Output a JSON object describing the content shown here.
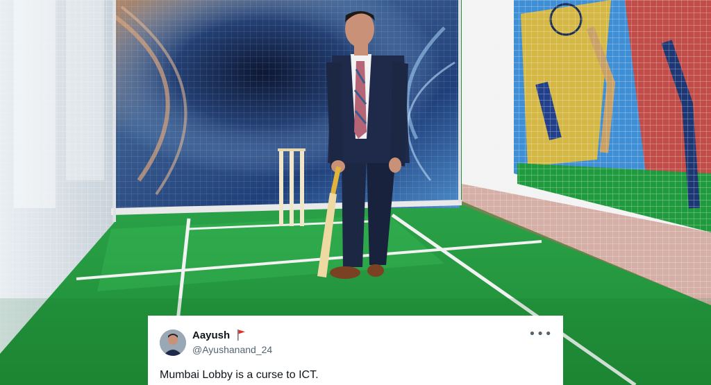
{
  "photo": {
    "description_icon": "cricket-practice-net-photo",
    "colors": {
      "turf": "#2e9a41",
      "net": "#e8ecef",
      "suit": "#1c2743",
      "backdrop": "#274a7a",
      "wall": "#f2f2f2"
    }
  },
  "tweet": {
    "display_name": "Aayush",
    "handle": "@Ayushanand_24",
    "text": "Mumbai Lobby is a curse to ICT.",
    "more_label": "•••",
    "flag_icon": "red-flag-icon"
  }
}
